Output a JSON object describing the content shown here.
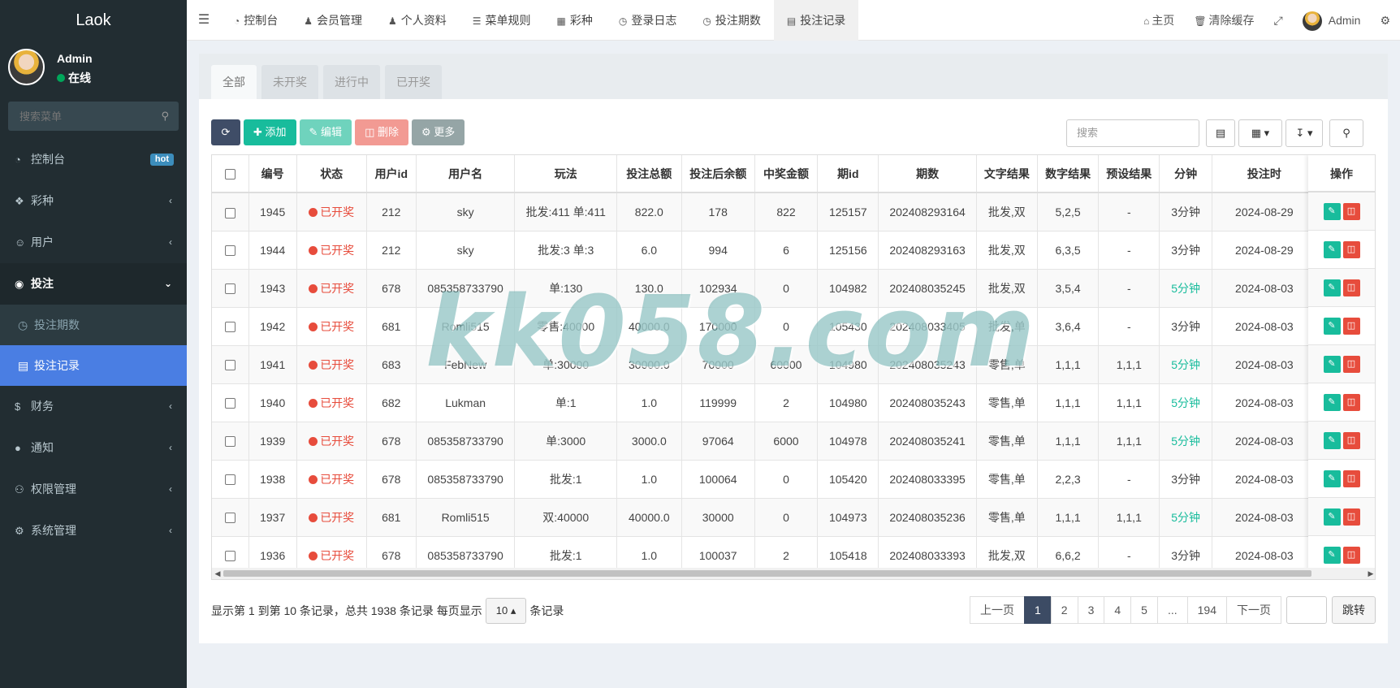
{
  "sidebar": {
    "brand": "Laok",
    "user_name": "Admin",
    "user_status": "在线",
    "search_placeholder": "搜索菜单",
    "items": [
      {
        "label": "控制台",
        "icon": "dashboard-icon",
        "badge": "hot"
      },
      {
        "label": "彩种",
        "icon": "cube-icon"
      },
      {
        "label": "用户",
        "icon": "user-circle-icon"
      },
      {
        "label": "投注",
        "icon": "bet-icon"
      },
      {
        "label": "财务",
        "icon": "dollar-icon"
      },
      {
        "label": "通知",
        "icon": "chat-icon"
      },
      {
        "label": "权限管理",
        "icon": "group-icon"
      },
      {
        "label": "系统管理",
        "icon": "cogs-icon"
      }
    ],
    "sub_items": [
      {
        "label": "投注期数",
        "icon": "clock-icon"
      },
      {
        "label": "投注记录",
        "icon": "list-icon"
      }
    ]
  },
  "topbar": {
    "tabs": [
      {
        "label": "控制台",
        "icon": "dashboard-icon"
      },
      {
        "label": "会员管理",
        "icon": "user-icon"
      },
      {
        "label": "个人资料",
        "icon": "user-icon"
      },
      {
        "label": "菜单规则",
        "icon": "bars-icon"
      },
      {
        "label": "彩种",
        "icon": "cube-icon"
      },
      {
        "label": "登录日志",
        "icon": "clock-icon"
      },
      {
        "label": "投注期数",
        "icon": "clock-icon"
      },
      {
        "label": "投注记录",
        "icon": "list-icon"
      }
    ],
    "home": "主页",
    "clear_cache": "清除缓存",
    "admin": "Admin"
  },
  "filters": [
    "全部",
    "未开奖",
    "进行中",
    "已开奖"
  ],
  "toolbar": {
    "add": "添加",
    "edit": "编辑",
    "delete": "删除",
    "more": "更多",
    "search_placeholder": "搜索"
  },
  "table": {
    "headers": [
      "编号",
      "状态",
      "用户id",
      "用户名",
      "玩法",
      "投注总额",
      "投注后余额",
      "中奖金额",
      "期id",
      "期数",
      "文字结果",
      "数字结果",
      "预设结果",
      "分钟",
      "投注时",
      "操作"
    ],
    "rows": [
      [
        "1945",
        "已开奖",
        "212",
        "sky",
        "批发:411 单:411",
        "822.0",
        "178",
        "822",
        "125157",
        "202408293164",
        "批发,双",
        "5,2,5",
        "-",
        "3分钟",
        "2024-08-29"
      ],
      [
        "1944",
        "已开奖",
        "212",
        "sky",
        "批发:3 单:3",
        "6.0",
        "994",
        "6",
        "125156",
        "202408293163",
        "批发,双",
        "6,3,5",
        "-",
        "3分钟",
        "2024-08-29"
      ],
      [
        "1943",
        "已开奖",
        "678",
        "085358733790",
        "单:130",
        "130.0",
        "102934",
        "0",
        "104982",
        "202408035245",
        "批发,双",
        "3,5,4",
        "-",
        "5分钟",
        "2024-08-03"
      ],
      [
        "1942",
        "已开奖",
        "681",
        "Romli515",
        "零售:40000",
        "40000.0",
        "170000",
        "0",
        "105430",
        "202408033405",
        "批发,单",
        "3,6,4",
        "-",
        "3分钟",
        "2024-08-03"
      ],
      [
        "1941",
        "已开奖",
        "683",
        "FebNew",
        "单:30000",
        "30000.0",
        "70000",
        "60000",
        "104980",
        "202408035243",
        "零售,单",
        "1,1,1",
        "1,1,1",
        "5分钟",
        "2024-08-03"
      ],
      [
        "1940",
        "已开奖",
        "682",
        "Lukman",
        "单:1",
        "1.0",
        "119999",
        "2",
        "104980",
        "202408035243",
        "零售,单",
        "1,1,1",
        "1,1,1",
        "5分钟",
        "2024-08-03"
      ],
      [
        "1939",
        "已开奖",
        "678",
        "085358733790",
        "单:3000",
        "3000.0",
        "97064",
        "6000",
        "104978",
        "202408035241",
        "零售,单",
        "1,1,1",
        "1,1,1",
        "5分钟",
        "2024-08-03"
      ],
      [
        "1938",
        "已开奖",
        "678",
        "085358733790",
        "批发:1",
        "1.0",
        "100064",
        "0",
        "105420",
        "202408033395",
        "零售,单",
        "2,2,3",
        "-",
        "3分钟",
        "2024-08-03"
      ],
      [
        "1937",
        "已开奖",
        "681",
        "Romli515",
        "双:40000",
        "40000.0",
        "30000",
        "0",
        "104973",
        "202408035236",
        "零售,单",
        "1,1,1",
        "1,1,1",
        "5分钟",
        "2024-08-03"
      ],
      [
        "1936",
        "已开奖",
        "678",
        "085358733790",
        "批发:1",
        "1.0",
        "100037",
        "2",
        "105418",
        "202408033393",
        "批发,双",
        "6,6,2",
        "-",
        "3分钟",
        "2024-08-03"
      ]
    ]
  },
  "footer": {
    "summary_prefix": "显示第 1 到第 10 条记录，总共 1938 条记录 每页显示",
    "page_size": "10",
    "summary_suffix": "条记录",
    "prev": "上一页",
    "pages": [
      "1",
      "2",
      "3",
      "4",
      "5",
      "...",
      "194"
    ],
    "next": "下一页",
    "jump": "跳转"
  },
  "watermark": "kk058.com",
  "colors": {
    "sidebar": "#222d32",
    "active_menu": "#4a7ee3",
    "success": "#18bc9c",
    "danger": "#e74c3c"
  }
}
